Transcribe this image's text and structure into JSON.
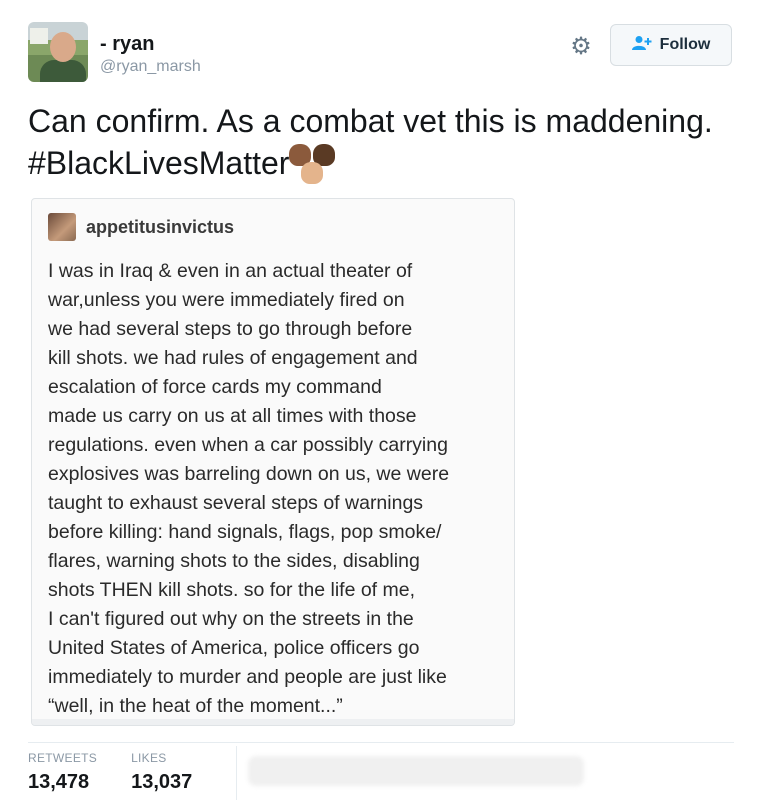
{
  "tweet": {
    "display_name": "- ryan",
    "handle": "@ryan_marsh",
    "follow_label": "Follow",
    "text": "Can confirm. As a combat vet this is maddening. #BlackLivesMatter"
  },
  "icons": {
    "settings": "gear-icon",
    "follow": "person-plus-icon",
    "emoji": "raised-fists-emoji"
  },
  "embedded_post": {
    "username": "appetitusinvictus",
    "body": "I was in Iraq & even in an actual theater of\nwar,unless you were immediately fired on\nwe had several steps to go through before\nkill shots. we had rules of engagement and\nescalation of force cards my command\nmade us carry on us at all times with those\nregulations. even when a car possibly carrying\nexplosives was barreling down on us, we were\ntaught to exhaust several steps of warnings\nbefore killing: hand signals, flags, pop smoke/\nflares, warning shots to the sides, disabling\nshots THEN kill shots. so for the life of me,\nI can't figured out why on the streets in the\nUnited States of America, police officers go\nimmediately to murder and people are just like\n“well, in the heat of the moment...”"
  },
  "stats": {
    "retweets_label": "RETWEETS",
    "retweets_value": "13,478",
    "likes_label": "LIKES",
    "likes_value": "13,037"
  },
  "colors": {
    "accent": "#1da1f2",
    "muted": "#8b98a5",
    "text": "#14171a"
  }
}
